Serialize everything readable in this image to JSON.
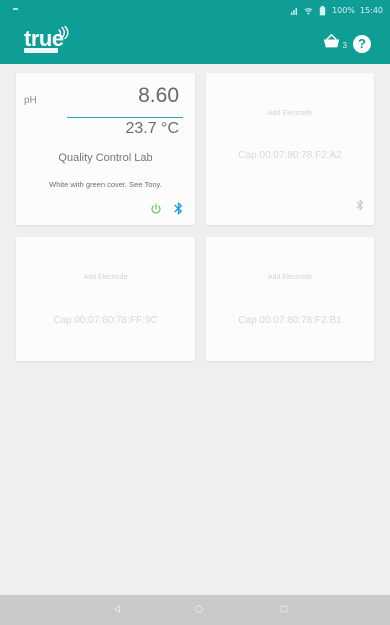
{
  "status_bar": {
    "battery": "100%",
    "time": "15:40"
  },
  "app_bar": {
    "logo_text": "true",
    "logo_subtitle": "",
    "basket_count": "3"
  },
  "cards": [
    {
      "label": "pH",
      "value": "8.60",
      "temperature": "23.7 °C",
      "location": "Quality Control Lab",
      "note": "White with green cover. See Tony."
    },
    {
      "add_label": "Add Electrode",
      "cap": "Cap 00:07:80:78:F2:A2"
    },
    {
      "add_label": "Add Electrode",
      "cap": "Cap 00:07:80:78:FF:9C"
    },
    {
      "add_label": "Add Electrode",
      "cap": "Cap 00:07:80:78:F2:B1"
    }
  ],
  "icons": {
    "signal": "signal-icon",
    "wifi": "wifi-icon",
    "battery": "battery-icon",
    "basket": "basket-icon",
    "help": "help-icon",
    "power": "power-icon",
    "bluetooth": "bluetooth-icon",
    "back": "back-icon",
    "home": "home-icon",
    "recent": "recent-apps-icon"
  },
  "colors": {
    "accent": "#0f9e95",
    "power_active": "#67c45e",
    "bluetooth_active": "#1c9fd5"
  }
}
